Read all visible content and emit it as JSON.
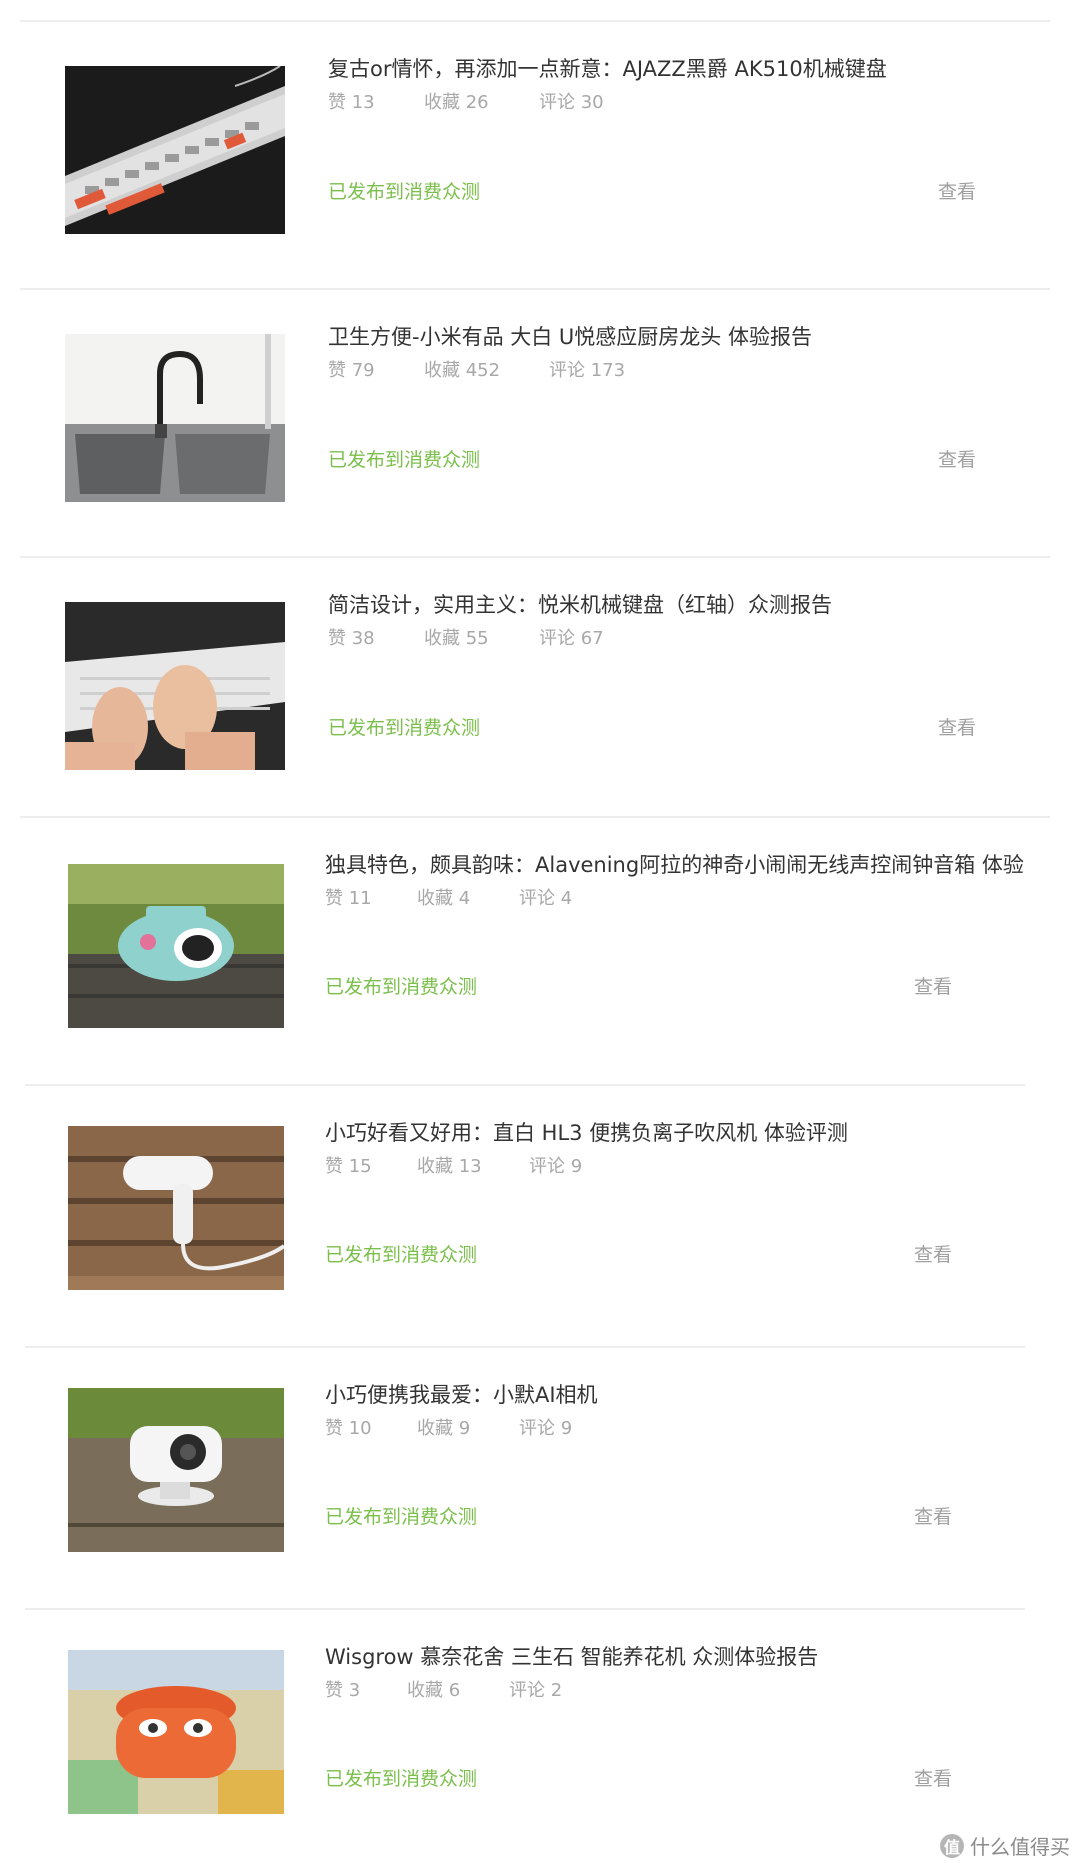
{
  "articles": [
    {
      "title": "复古or情怀，再添加一点新意：AJAZZ黑爵 AK510机械键盘",
      "likes": "赞 13",
      "favorites": "收藏 26",
      "comments": "评论 30",
      "status": "已发布到消费众测",
      "action": "查看",
      "thumb_icon": "keyboard-photo-icon"
    },
    {
      "title": "卫生方便-小米有品 大白 U悦感应厨房龙头 体验报告",
      "likes": "赞 79",
      "favorites": "收藏 452",
      "comments": "评论 173",
      "status": "已发布到消费众测",
      "action": "查看",
      "thumb_icon": "faucet-photo-icon"
    },
    {
      "title": "简洁设计，实用主义：悦米机械键盘（红轴）众测报告",
      "likes": "赞 38",
      "favorites": "收藏 55",
      "comments": "评论 67",
      "status": "已发布到消费众测",
      "action": "查看",
      "thumb_icon": "white-keyboard-photo-icon"
    },
    {
      "title": "独具特色，颇具韵味：Alavening阿拉的神奇小闹闹无线声控闹钟音箱 体验",
      "likes": "赞 11",
      "favorites": "收藏 4",
      "comments": "评论 4",
      "status": "已发布到消费众测",
      "action": "查看",
      "thumb_icon": "speaker-photo-icon"
    },
    {
      "title": "小巧好看又好用：直白 HL3 便携负离子吹风机 体验评测",
      "likes": "赞 15",
      "favorites": "收藏 13",
      "comments": "评论 9",
      "status": "已发布到消费众测",
      "action": "查看",
      "thumb_icon": "hairdryer-photo-icon"
    },
    {
      "title": "小巧便携我最爱：小默AI相机",
      "likes": "赞 10",
      "favorites": "收藏 9",
      "comments": "评论 9",
      "status": "已发布到消费众测",
      "action": "查看",
      "thumb_icon": "camera-photo-icon"
    },
    {
      "title": "Wisgrow 慕奈花舍 三生石 智能养花机 众测体验报告",
      "likes": "赞 3",
      "favorites": "收藏 6",
      "comments": "评论 2",
      "status": "已发布到消费众测",
      "action": "查看",
      "thumb_icon": "planter-photo-icon"
    }
  ],
  "watermark": {
    "logo": "值",
    "text": "什么值得买"
  }
}
